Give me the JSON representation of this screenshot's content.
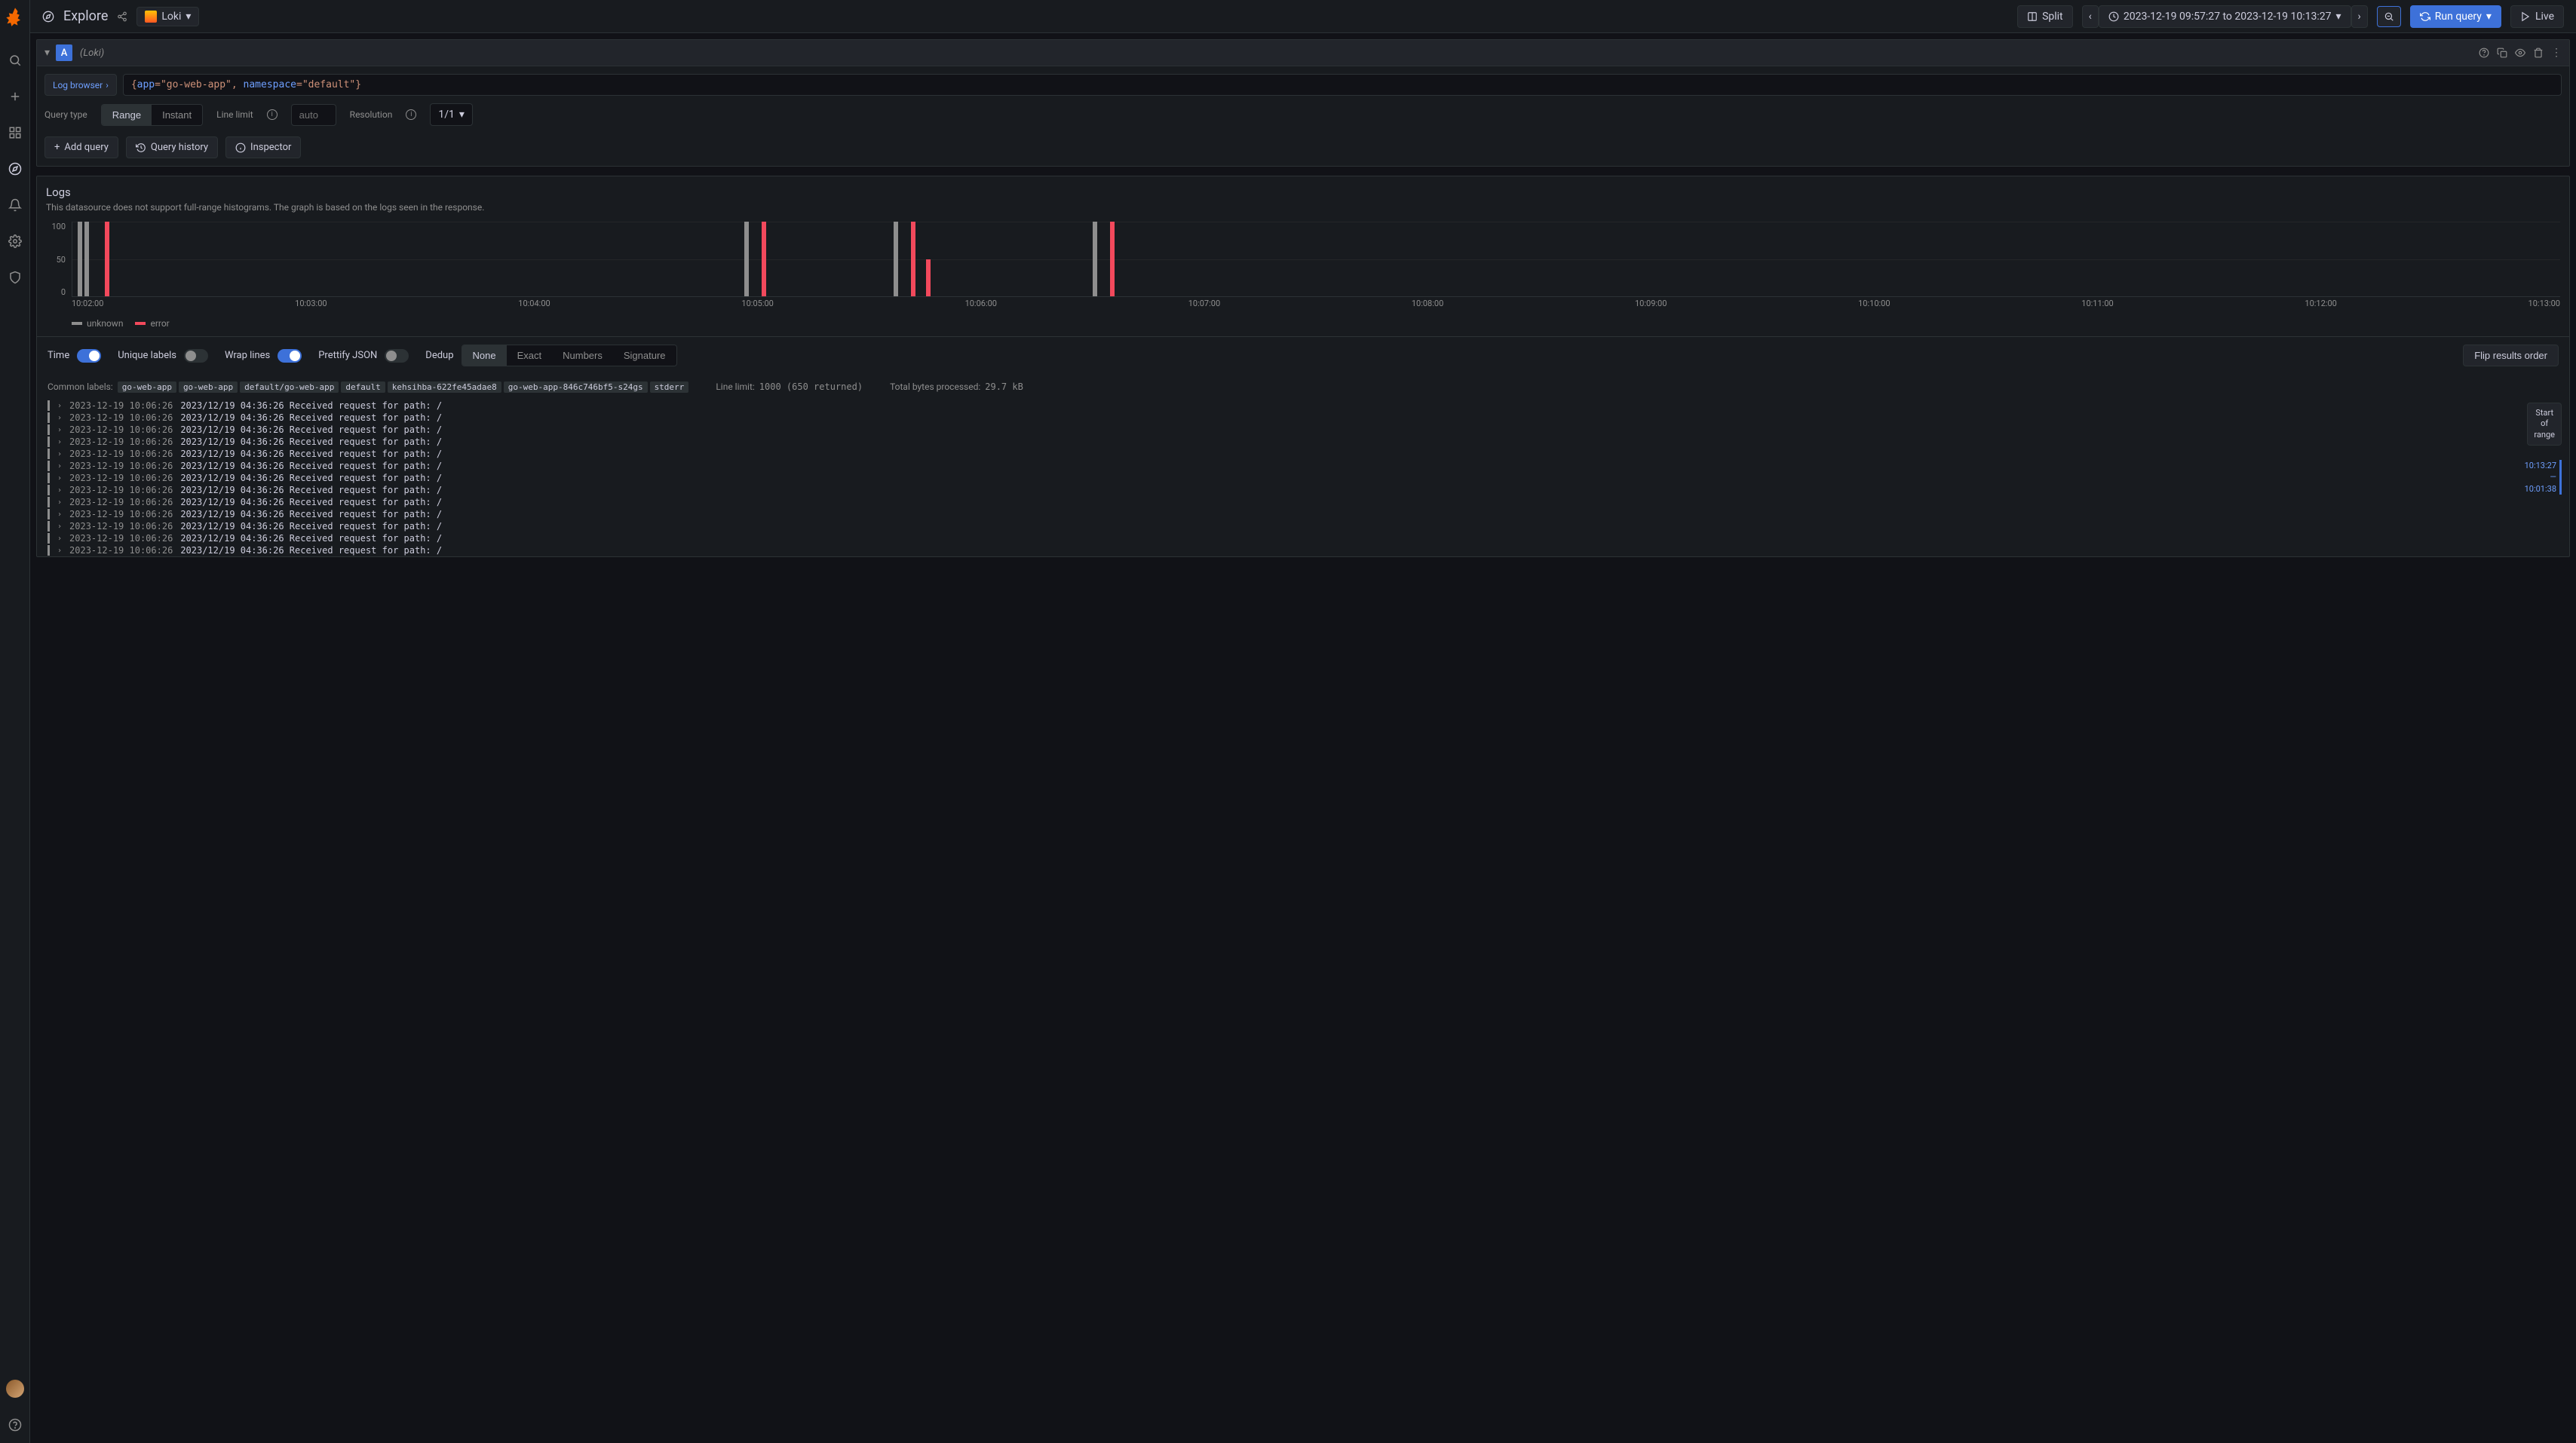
{
  "page": {
    "title": "Explore"
  },
  "datasource": {
    "name": "Loki",
    "subtitle": "(Loki)"
  },
  "toolbar": {
    "split": "Split",
    "time_range": "2023-12-19 09:57:27 to 2023-12-19 10:13:27",
    "run": "Run query",
    "live": "Live"
  },
  "query": {
    "row_label": "A",
    "log_browser": "Log browser",
    "expr_display": "{app=\"go-web-app\", namespace=\"default\"}",
    "type_label": "Query type",
    "type_range": "Range",
    "type_instant": "Instant",
    "line_limit_label": "Line limit",
    "line_limit_placeholder": "auto",
    "resolution_label": "Resolution",
    "resolution_value": "1/1"
  },
  "actions": {
    "add_query": "Add query",
    "history": "Query history",
    "inspector": "Inspector"
  },
  "logs": {
    "title": "Logs",
    "note": "This datasource does not support full-range histograms. The graph is based on the logs seen in the response.",
    "legend_unknown": "unknown",
    "legend_error": "error"
  },
  "controls": {
    "time": "Time",
    "unique": "Unique labels",
    "wrap": "Wrap lines",
    "prettify": "Prettify JSON",
    "dedup": "Dedup",
    "dedup_none": "None",
    "dedup_exact": "Exact",
    "dedup_numbers": "Numbers",
    "dedup_signature": "Signature",
    "flip": "Flip results order"
  },
  "meta": {
    "common_labels": "Common labels:",
    "labels": [
      "go-web-app",
      "go-web-app",
      "default/go-web-app",
      "default",
      "kehsihba-622fe45adae8",
      "go-web-app-846c746bf5-s24gs",
      "stderr"
    ],
    "line_limit_label": "Line limit:",
    "line_limit_value": "1000 (650 returned)",
    "bytes_label": "Total bytes processed:",
    "bytes_value": "29.7 kB"
  },
  "range_badge": {
    "l1": "Start",
    "l2": "of",
    "l3": "range"
  },
  "scroll_ts": {
    "top": "10:13:27",
    "dash": "—",
    "bottom": "10:01:38"
  },
  "log_rows": [
    {
      "ts": "2023-12-19 10:06:26",
      "msg": "2023/12/19 04:36:26 Received request for path: /"
    },
    {
      "ts": "2023-12-19 10:06:26",
      "msg": "2023/12/19 04:36:26 Received request for path: /"
    },
    {
      "ts": "2023-12-19 10:06:26",
      "msg": "2023/12/19 04:36:26 Received request for path: /"
    },
    {
      "ts": "2023-12-19 10:06:26",
      "msg": "2023/12/19 04:36:26 Received request for path: /"
    },
    {
      "ts": "2023-12-19 10:06:26",
      "msg": "2023/12/19 04:36:26 Received request for path: /"
    },
    {
      "ts": "2023-12-19 10:06:26",
      "msg": "2023/12/19 04:36:26 Received request for path: /"
    },
    {
      "ts": "2023-12-19 10:06:26",
      "msg": "2023/12/19 04:36:26 Received request for path: /"
    },
    {
      "ts": "2023-12-19 10:06:26",
      "msg": "2023/12/19 04:36:26 Received request for path: /"
    },
    {
      "ts": "2023-12-19 10:06:26",
      "msg": "2023/12/19 04:36:26 Received request for path: /"
    },
    {
      "ts": "2023-12-19 10:06:26",
      "msg": "2023/12/19 04:36:26 Received request for path: /"
    },
    {
      "ts": "2023-12-19 10:06:26",
      "msg": "2023/12/19 04:36:26 Received request for path: /"
    },
    {
      "ts": "2023-12-19 10:06:26",
      "msg": "2023/12/19 04:36:26 Received request for path: /"
    },
    {
      "ts": "2023-12-19 10:06:26",
      "msg": "2023/12/19 04:36:26 Received request for path: /"
    }
  ],
  "chart_data": {
    "type": "bar",
    "ylim": [
      0,
      100
    ],
    "yticks": [
      100,
      50,
      0
    ],
    "xticks": [
      "10:02:00",
      "10:03:00",
      "10:04:00",
      "10:05:00",
      "10:06:00",
      "10:07:00",
      "10:08:00",
      "10:09:00",
      "10:10:00",
      "10:11:00",
      "10:12:00",
      "10:13:00"
    ],
    "series": [
      {
        "name": "unknown",
        "color": "#8e8e8e",
        "bars": [
          {
            "x": 0.2,
            "h": 100
          },
          {
            "x": 0.5,
            "h": 100
          },
          {
            "x": 27,
            "h": 100
          },
          {
            "x": 33,
            "h": 100
          },
          {
            "x": 41,
            "h": 100
          }
        ]
      },
      {
        "name": "error",
        "color": "#f2495c",
        "bars": [
          {
            "x": 1.3,
            "h": 100
          },
          {
            "x": 27.7,
            "h": 100
          },
          {
            "x": 33.7,
            "h": 100
          },
          {
            "x": 34.3,
            "h": 50
          },
          {
            "x": 41.7,
            "h": 100
          }
        ]
      }
    ]
  }
}
